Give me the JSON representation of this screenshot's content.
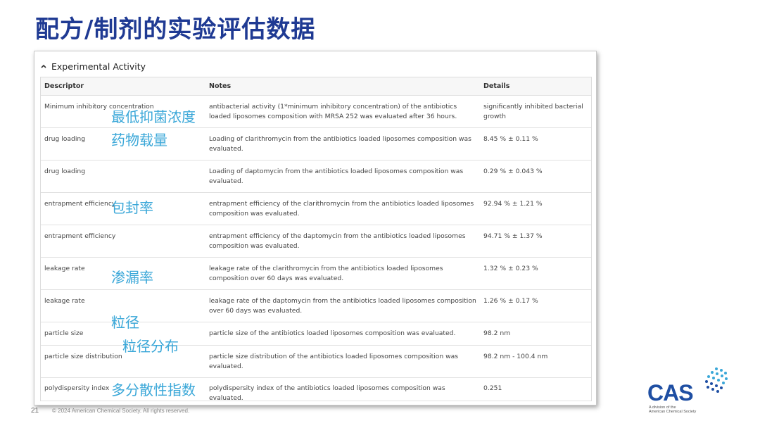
{
  "slide": {
    "title": "配方/制剂的实验评估数据",
    "page_number": "21",
    "copyright": "© 2024 American Chemical Society. All rights reserved."
  },
  "panel": {
    "header": "Experimental Activity",
    "header_icon": "chevron-up-icon"
  },
  "table": {
    "columns": [
      "Descriptor",
      "Notes",
      "Details"
    ],
    "rows": [
      {
        "descriptor": "Minimum inhibitory concentration",
        "notes": "antibacterial activity (1*minimum inhibitory concentration) of the antibiotics loaded liposomes composition with MRSA 252 was evaluated after 36 hours.",
        "details": "significantly inhibited bacterial growth"
      },
      {
        "descriptor": "drug loading",
        "notes": "Loading of clarithromycin from the antibiotics loaded liposomes composition was evaluated.",
        "details": "8.45 % ± 0.11 %"
      },
      {
        "descriptor": "drug loading",
        "notes": "Loading of daptomycin from the antibiotics loaded liposomes composition was evaluated.",
        "details": "0.29 % ± 0.043 %"
      },
      {
        "descriptor": "entrapment efficiency",
        "notes": "entrapment efficiency of the clarithromycin from the antibiotics loaded liposomes composition was evaluated.",
        "details": "92.94 % ± 1.21 %"
      },
      {
        "descriptor": "entrapment efficiency",
        "notes": "entrapment efficiency of the daptomycin from the antibiotics loaded liposomes composition was evaluated.",
        "details": "94.71 % ± 1.37 %"
      },
      {
        "descriptor": "leakage rate",
        "notes": "leakage rate of the clarithromycin from the antibiotics loaded liposomes composition over 60 days was evaluated.",
        "details": "1.32 % ± 0.23 %"
      },
      {
        "descriptor": "leakage rate",
        "notes": "leakage rate of the daptomycin from the antibiotics loaded liposomes composition over 60 days was evaluated.",
        "details": "1.26 % ± 0.17 %"
      },
      {
        "descriptor": "particle size",
        "notes": "particle size of the antibiotics loaded liposomes composition was evaluated.",
        "details": "98.2 nm"
      },
      {
        "descriptor": "particle size distribution",
        "notes": "particle size distribution of the antibiotics loaded liposomes composition was evaluated.",
        "details": "98.2 nm - 100.4 nm"
      },
      {
        "descriptor": "polydispersity index",
        "notes": "polydispersity index of the antibiotics loaded liposomes composition was evaluated.",
        "details": "0.251"
      }
    ]
  },
  "annotations": {
    "mic": "最低抑菌浓度",
    "drug_loading": "药物载量",
    "entrapment": "包封率",
    "leakage": "渗漏率",
    "particle_size": "粒径",
    "psd": "粒径分布",
    "pdi": "多分散性指数"
  },
  "logo": {
    "text": "CAS",
    "sub1": "A division of the",
    "sub2": "American Chemical Society",
    "icon": "dot-helix-icon",
    "accent": "#3aa7d8",
    "brand": "#1f4fa3"
  }
}
